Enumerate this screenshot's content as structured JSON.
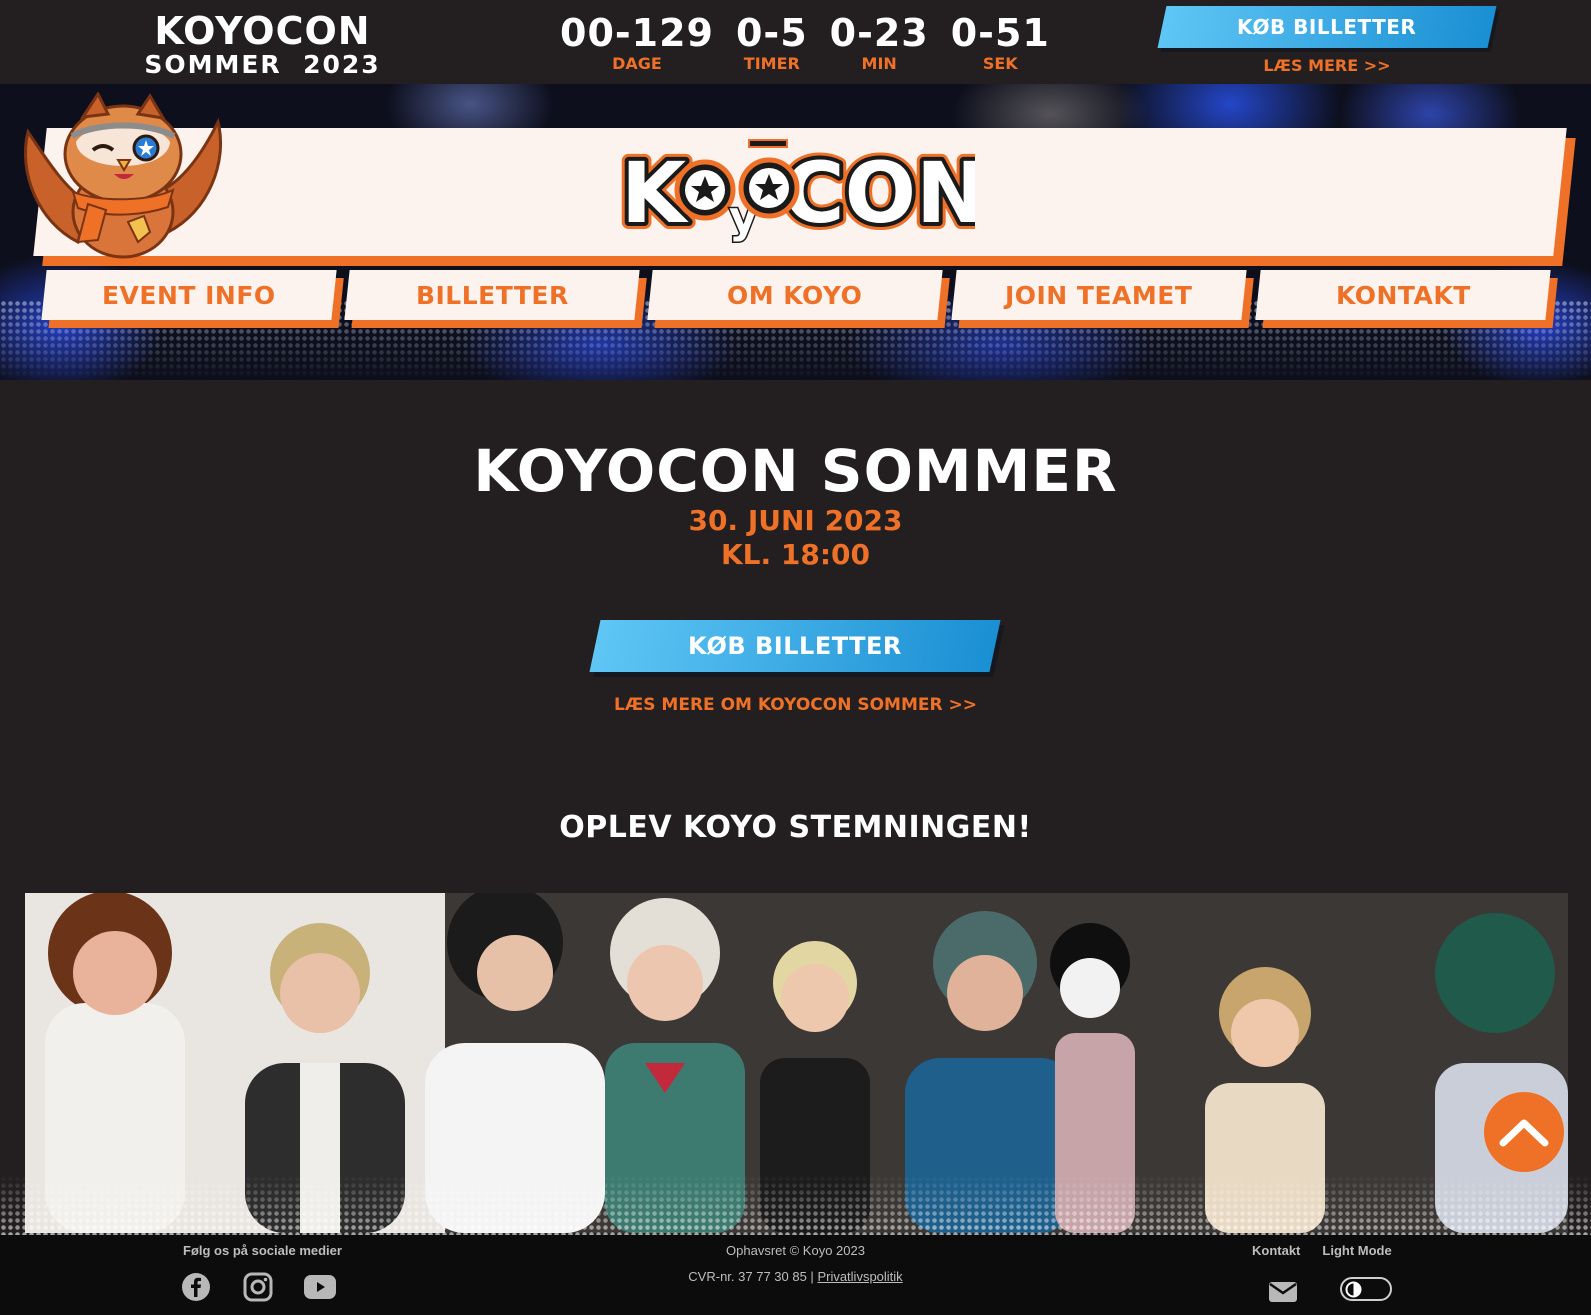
{
  "topbar": {
    "event_line1": "KOYOCON",
    "event_line2": "SOMMER  2023",
    "countdown": [
      {
        "value": "00-129",
        "label": "DAGE"
      },
      {
        "value": "0-5",
        "label": "TIMER"
      },
      {
        "value": "0-23",
        "label": "MIN"
      },
      {
        "value": "0-51",
        "label": "SEK"
      }
    ],
    "cta_label": "KØB BILLETTER",
    "more_label": "LÆS MERE >>"
  },
  "brand": {
    "logo_text": "KoyoCON",
    "accent": "#ee7127",
    "blue": "#1a8fd3",
    "background": "#231f20"
  },
  "nav": {
    "items": [
      {
        "label": "EVENT INFO"
      },
      {
        "label": "BILLETTER"
      },
      {
        "label": "OM KOYO"
      },
      {
        "label": "JOIN TEAMET"
      },
      {
        "label": "KONTAKT"
      }
    ]
  },
  "main": {
    "title": "KOYOCON SOMMER",
    "date": "30. JUNI 2023",
    "time": "KL. 18:00",
    "cta_label": "KØB BILLETTER",
    "more_label": "LÆS MERE OM KOYOCON SOMMER >>",
    "section_title": "OPLEV KOYO STEMNINGEN!"
  },
  "footer": {
    "social_label": "Følg os på sociale medier",
    "social_icons": [
      "facebook-icon",
      "instagram-icon",
      "youtube-icon"
    ],
    "copyright": "Ophavsret © Koyo 2023",
    "cvr": "CVR-nr. 37 77 30 85 |",
    "privacy": "Privatlivspolitik",
    "contact": "Kontakt",
    "light_mode": "Light Mode"
  }
}
